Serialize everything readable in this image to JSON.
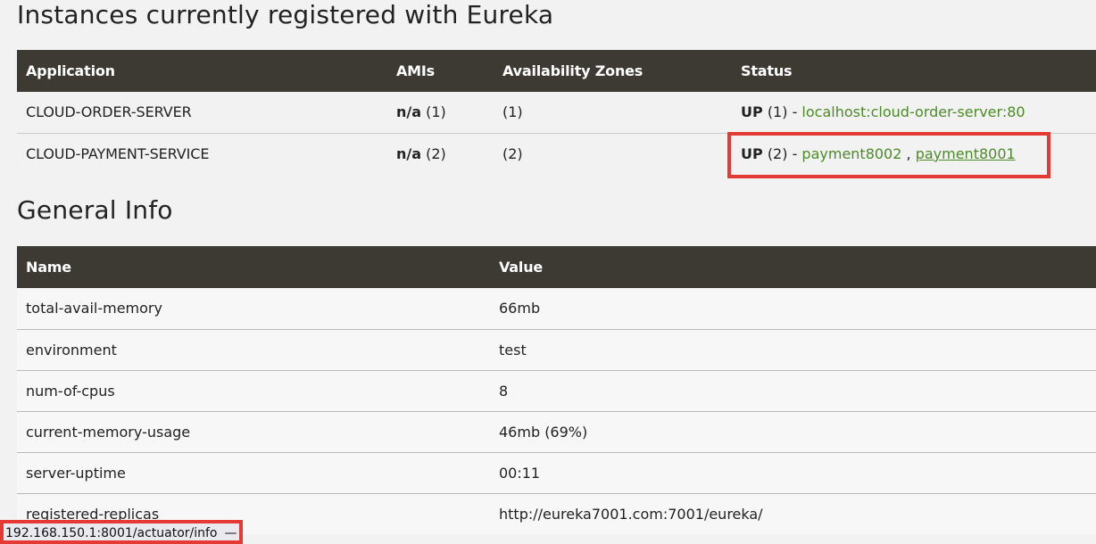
{
  "instances": {
    "title": "Instances currently registered with Eureka",
    "headers": [
      "Application",
      "AMIs",
      "Availability Zones",
      "Status"
    ],
    "rows": [
      {
        "application": "CLOUD-ORDER-SERVER",
        "ami_label": "n/a",
        "ami_count": "(1)",
        "zones": "(1)",
        "status_label": "UP",
        "status_count": "(1) - ",
        "links": [
          "localhost:cloud-order-server:80"
        ]
      },
      {
        "application": "CLOUD-PAYMENT-SERVICE",
        "ami_label": "n/a",
        "ami_count": "(2)",
        "zones": "(2)",
        "status_label": "UP",
        "status_count": "(2) - ",
        "links": [
          "payment8002",
          "payment8001"
        ],
        "link_separator": " , "
      }
    ]
  },
  "general": {
    "title": "General Info",
    "headers": [
      "Name",
      "Value"
    ],
    "rows": [
      {
        "name": "total-avail-memory",
        "value": "66mb"
      },
      {
        "name": "environment",
        "value": "test"
      },
      {
        "name": "num-of-cpus",
        "value": "8"
      },
      {
        "name": "current-memory-usage",
        "value": "46mb (69%)"
      },
      {
        "name": "server-uptime",
        "value": "00:11"
      },
      {
        "name": "registered-replicas",
        "value": "http://eureka7001.com:7001/eureka/"
      }
    ]
  },
  "status_bar": {
    "url": "192.168.150.1:8001/actuator/info",
    "suffix": "—"
  },
  "colors": {
    "header_bg": "#3d3a34",
    "link_green": "#4d8a28",
    "highlight_red": "#e53935",
    "page_bg": "#f2f2f2"
  }
}
